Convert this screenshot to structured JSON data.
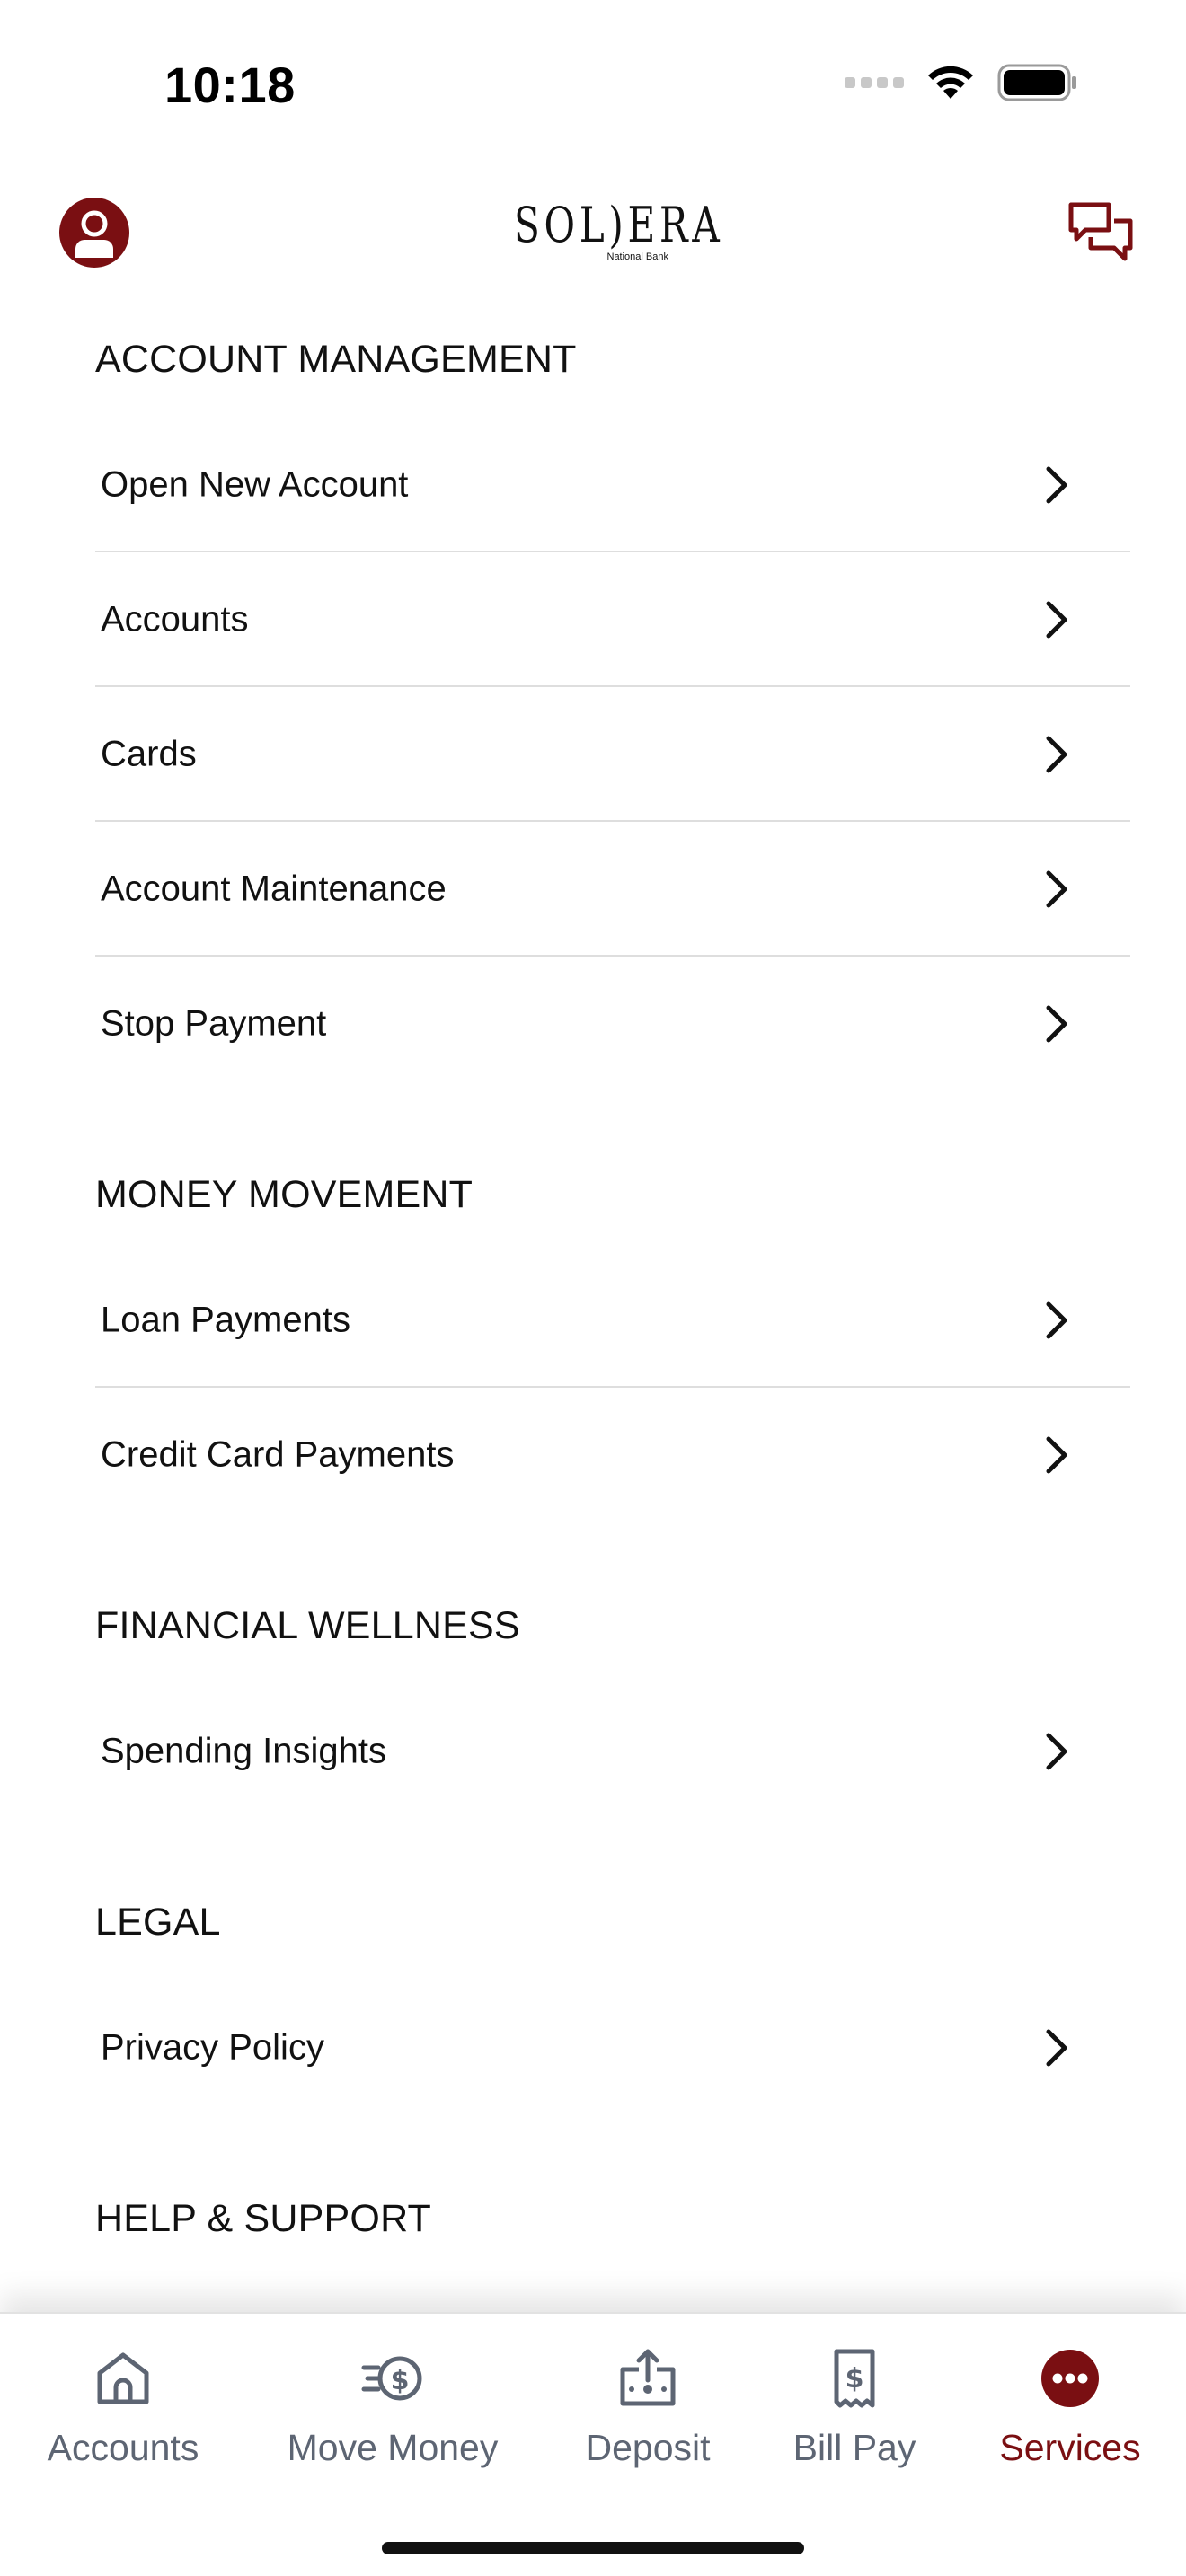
{
  "status": {
    "time": "10:18"
  },
  "header": {
    "logo_text": "SOL)ERA",
    "logo_subtitle": "National Bank",
    "avatar_icon": "user-icon",
    "chat_icon": "chat-bubbles-icon"
  },
  "sections": [
    {
      "title": "ACCOUNT MANAGEMENT",
      "items": [
        "Open New Account",
        "Accounts",
        "Cards",
        "Account Maintenance",
        "Stop Payment"
      ]
    },
    {
      "title": "MONEY MOVEMENT",
      "items": [
        "Loan Payments",
        "Credit Card Payments"
      ]
    },
    {
      "title": "FINANCIAL WELLNESS",
      "items": [
        "Spending Insights"
      ]
    },
    {
      "title": "LEGAL",
      "items": [
        "Privacy Policy"
      ]
    },
    {
      "title": "HELP & SUPPORT",
      "items": []
    }
  ],
  "tabs": [
    {
      "label": "Accounts",
      "icon": "home-icon"
    },
    {
      "label": "Move Money",
      "icon": "transfer-dollar-icon"
    },
    {
      "label": "Deposit",
      "icon": "check-deposit-icon"
    },
    {
      "label": "Bill Pay",
      "icon": "bill-receipt-icon"
    },
    {
      "label": "Services",
      "icon": "more-dots-icon",
      "active": true
    }
  ],
  "colors": {
    "brand": "#7a0f12",
    "tab_inactive": "#5d6573",
    "divider": "#dedede"
  }
}
